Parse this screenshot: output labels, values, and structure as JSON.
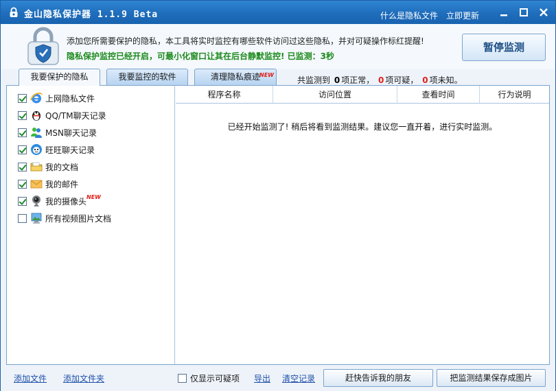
{
  "title_bar": {
    "app_title": "金山隐私保护器 1.1.9 Beta",
    "links": [
      "什么是隐私文件",
      "立即更新"
    ]
  },
  "header": {
    "description": "添加您所需要保护的隐私，本工具将实时监控有哪些软件访问过这些隐私，并对可疑操作标红提醒!",
    "status": "隐私保护监控已经开启，可最小化窗口让其在后台静默监控! 已监测：3秒",
    "pause_button": "暂停监测"
  },
  "tabs": [
    {
      "label": "我要保护的隐私",
      "active": true
    },
    {
      "label": "我要监控的软件",
      "active": false
    },
    {
      "label": "清理隐私痕迹",
      "active": false,
      "badge": "NEW"
    }
  ],
  "stats": {
    "prefix": "共监测到",
    "normal_count": "0",
    "normal_label": "项正常，",
    "suspicious_count": "0",
    "suspicious_label": "项可疑，",
    "unknown_count": "0",
    "unknown_label": "项未知。"
  },
  "privacy_items": [
    {
      "label": "上网隐私文件",
      "checked": true,
      "icon": "ie-icon"
    },
    {
      "label": "QQ/TM聊天记录",
      "checked": true,
      "icon": "qq-penguin-icon"
    },
    {
      "label": "MSN聊天记录",
      "checked": true,
      "icon": "msn-icon"
    },
    {
      "label": "旺旺聊天记录",
      "checked": true,
      "icon": "wangwang-icon"
    },
    {
      "label": "我的文档",
      "checked": true,
      "icon": "folder-icon"
    },
    {
      "label": "我的邮件",
      "checked": true,
      "icon": "mail-icon"
    },
    {
      "label": "我的摄像头",
      "checked": true,
      "icon": "webcam-icon",
      "badge": "NEW"
    },
    {
      "label": "所有视频图片文档",
      "checked": false,
      "icon": "media-files-icon"
    }
  ],
  "table": {
    "columns": [
      "程序名称",
      "访问位置",
      "查看时间",
      "行为说明"
    ],
    "empty_message": "已经开始监测了! 稍后将看到监测结果。建议您一直开着，进行实时监测。"
  },
  "bottom": {
    "add_file": "添加文件",
    "add_folder": "添加文件夹",
    "only_suspicious_label": "仅显示可疑项",
    "only_suspicious_checked": false,
    "export": "导出",
    "clear_records": "清空记录",
    "tell_friends": "赶快告诉我的朋友",
    "save_as_image": "把监测结果保存成图片"
  },
  "colors": {
    "titlebar": "#1f6dbb",
    "status_green": "#1c8a1c",
    "warning_red": "#e0201a",
    "link_blue": "#1f50a8"
  }
}
